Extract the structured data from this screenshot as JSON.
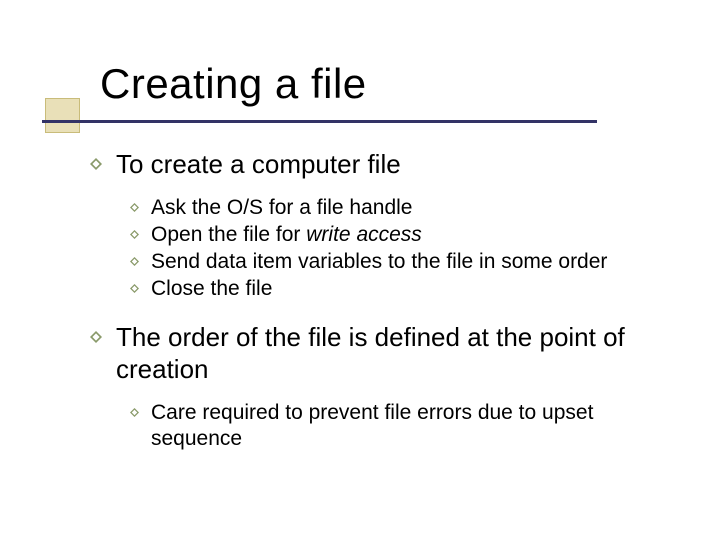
{
  "title": "Creating a file",
  "points": [
    {
      "text": "To create a computer file",
      "sub": [
        {
          "text": "Ask the O/S for a file handle"
        },
        {
          "prefix": "Open the file for ",
          "em": "write access",
          "suffix": ""
        },
        {
          "text": "Send data item variables to the file in some order"
        },
        {
          "text": "Close the file"
        }
      ]
    },
    {
      "text": "The order of the file is defined at the point of creation",
      "sub": [
        {
          "text": "Care required to prevent file errors due to upset sequence"
        }
      ]
    }
  ]
}
